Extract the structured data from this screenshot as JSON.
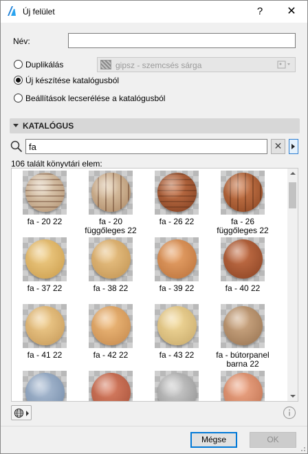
{
  "window": {
    "title": "Új felület",
    "help": "?",
    "close": "✕"
  },
  "form": {
    "name_label": "Név:",
    "name_value": "",
    "options": [
      {
        "label": "Duplikálás",
        "selected": false
      },
      {
        "label": "Új készítése katalógusból",
        "selected": true
      },
      {
        "label": "Beállítások lecserélése a katalógusból",
        "selected": false
      }
    ],
    "duplicate_source": "gipsz - szemcsés sárga"
  },
  "catalog": {
    "section_title": "KATALÓGUS",
    "search_value": "fa",
    "result_count": "106 talált könyvtári elem:",
    "items": [
      {
        "label": "fa - 20 22",
        "colors": [
          "#e6d6bf",
          "#b08f6e"
        ],
        "stripes": "h"
      },
      {
        "label": "fa - 20 függőleges 22",
        "colors": [
          "#e3cdb0",
          "#a98460"
        ],
        "stripes": "v"
      },
      {
        "label": "fa - 26 22",
        "colors": [
          "#c9764b",
          "#7d3d1f"
        ],
        "stripes": "h"
      },
      {
        "label": "fa - 26 függőleges 22",
        "colors": [
          "#cf7d4f",
          "#87421f"
        ],
        "stripes": "v"
      },
      {
        "label": "fa - 37 22",
        "colors": [
          "#f1cf89",
          "#c99a48"
        ],
        "stripes": ""
      },
      {
        "label": "fa - 38 22",
        "colors": [
          "#ecc587",
          "#bf9150"
        ],
        "stripes": ""
      },
      {
        "label": "fa - 39 22",
        "colors": [
          "#eaa56b",
          "#b86f38"
        ],
        "stripes": ""
      },
      {
        "label": "fa - 40 22",
        "colors": [
          "#c9734a",
          "#864021"
        ],
        "stripes": ""
      },
      {
        "label": "fa - 41 22",
        "colors": [
          "#f2cf8f",
          "#c39656"
        ],
        "stripes": ""
      },
      {
        "label": "fa - 42 22",
        "colors": [
          "#f1bc7c",
          "#c2864a"
        ],
        "stripes": ""
      },
      {
        "label": "fa - 43 22",
        "colors": [
          "#f4db9c",
          "#c5a768"
        ],
        "stripes": ""
      },
      {
        "label": "fa - bútorpanel barna 22",
        "colors": [
          "#d2ad88",
          "#94704e"
        ],
        "stripes": ""
      },
      {
        "label": "",
        "colors": [
          "#aebfd5",
          "#7088a6"
        ],
        "stripes": ""
      },
      {
        "label": "",
        "colors": [
          "#dc8266",
          "#a44f37"
        ],
        "stripes": ""
      },
      {
        "label": "",
        "colors": [
          "#cfcfcf",
          "#8e8e8e"
        ],
        "stripes": ""
      },
      {
        "label": "",
        "colors": [
          "#f0a989",
          "#bd6f4d"
        ],
        "stripes": ""
      }
    ]
  },
  "footer": {
    "cancel": "Mégse",
    "ok": "OK"
  },
  "accent_color": "#0078d7"
}
